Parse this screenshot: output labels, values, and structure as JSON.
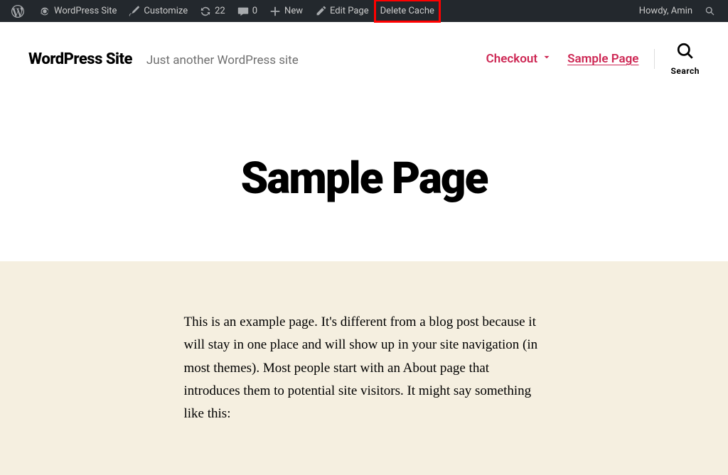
{
  "adminbar": {
    "site_name": "WordPress Site",
    "customize": "Customize",
    "updates_count": "22",
    "comments_count": "0",
    "new": "New",
    "edit_page": "Edit Page",
    "delete_cache": "Delete Cache",
    "howdy": "Howdy, Amin"
  },
  "header": {
    "site_title": "WordPress Site",
    "tagline": "Just another WordPress site",
    "nav": {
      "checkout": "Checkout",
      "sample_page": "Sample Page"
    },
    "search_label": "Search"
  },
  "page": {
    "title": "Sample Page",
    "body": "This is an example page. It's different from a blog post because it will stay in one place and will show up in your site navigation (in most themes). Most people start with an About page that introduces them to potential site visitors. It might say something like this:"
  }
}
